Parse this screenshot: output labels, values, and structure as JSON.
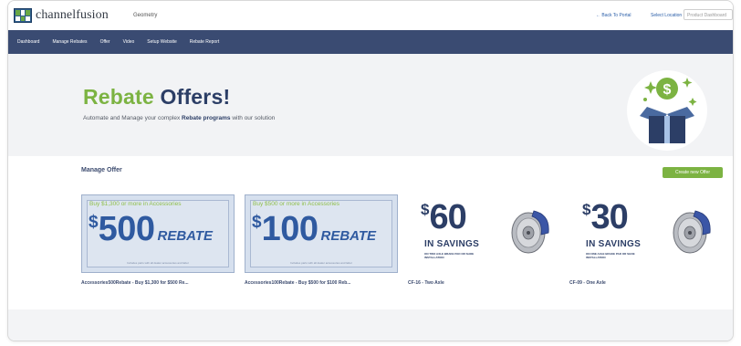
{
  "header": {
    "logo_text": "channelfusion",
    "brand_name": "Geometry",
    "back_link": "← Back To Portal",
    "select_label": "Select Location",
    "location_placeholder": "Product Dashboard"
  },
  "nav": {
    "items": [
      "Dashboard",
      "Manage Rebates",
      "Offer",
      "Video",
      "Setup Website",
      "Rebate Report"
    ]
  },
  "hero": {
    "title_word1": "Rebate",
    "title_word2": "Offers!",
    "subtitle_prefix": "Automate and Manage your complex",
    "subtitle_bold": "Rebate programs",
    "subtitle_suffix": "with our solution"
  },
  "content": {
    "section_title": "Manage Offer",
    "create_button": "Create new Offer",
    "cards": [
      {
        "type": "rebate",
        "top_text": "Buy $1,300 or more in Accessories",
        "dollar": "$",
        "amount": "500",
        "word": "REBATE",
        "fine": "Includes parts with all dealer accessories and labor",
        "caption": "Accessories500Rebate - Buy $1,300 for $500 Re..."
      },
      {
        "type": "rebate",
        "top_text": "Buy $500 or more in Accessories",
        "dollar": "$",
        "amount": "100",
        "word": "REBATE",
        "fine": "Includes parts with all dealer accessories and labor",
        "caption": "Accessories100Rebate - Buy $500 for $100 Reb..."
      },
      {
        "type": "savings",
        "dollar": "$",
        "amount": "60",
        "word": "IN SAVINGS",
        "fine": "ON TWO AXLE BRAKE PAD OR SHOE INSTALLATION",
        "caption": "CF-16 - Two Axle"
      },
      {
        "type": "savings",
        "dollar": "$",
        "amount": "30",
        "word": "IN SAVINGS",
        "fine": "ON ONE AXLE BRAKE PAD OR SHOE INSTALLATION",
        "caption": "CF-09 - One Axle"
      }
    ]
  },
  "colors": {
    "nav_bg": "#3a4b72",
    "accent_green": "#7cb342",
    "navy": "#2c3e66",
    "rebate_blue": "#2f5aa0"
  }
}
